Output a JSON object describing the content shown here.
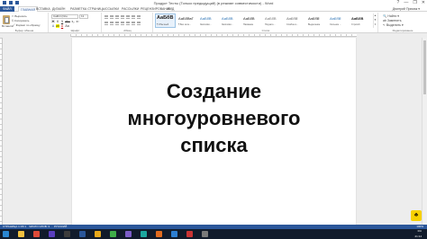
{
  "window": {
    "title": "Продукт Тесты (Только предыдущий) (в режиме совместимости) - Word",
    "controls": [
      "?",
      "—",
      "❐",
      "✕"
    ]
  },
  "tabs": [
    {
      "label": "ФАЙЛ",
      "kind": "file"
    },
    {
      "label": "ГЛАВНАЯ",
      "kind": "active"
    },
    {
      "label": "ВСТАВКА"
    },
    {
      "label": "ДИЗАЙН"
    },
    {
      "label": "РАЗМЕТКА СТРАНИЦЫ"
    },
    {
      "label": "ССЫЛКИ"
    },
    {
      "label": "РАССЫЛКИ"
    },
    {
      "label": "РЕЦЕНЗИРОВАНИЕ"
    },
    {
      "label": "ВИД"
    }
  ],
  "account": {
    "label": "Дмитрий Примак ▾"
  },
  "ribbon": {
    "clipboard": {
      "paste_label": "Вставить",
      "items": [
        "✂ Вырезать",
        "⎘ Копировать",
        "🖌 Формат по образцу"
      ],
      "group_label": "Буфер обмена"
    },
    "font": {
      "font_name": "Calibri (Осн",
      "font_size": "11",
      "row2": [
        "Ж",
        "К",
        "Ч",
        "abc",
        "x₂",
        "x²"
      ],
      "row3": [
        "A",
        "ab",
        "A",
        "Aa"
      ],
      "group_label": "Шрифт"
    },
    "paragraph": {
      "group_label": "Абзац"
    },
    "styles": {
      "items": [
        {
          "sample": "АаБбВ",
          "name": "¶ Обычный",
          "big": true,
          "selected": true
        },
        {
          "sample": "АаБбВвГ",
          "name": "¶ Без инте..."
        },
        {
          "sample": "АаБбВ",
          "name": "Заголово..."
        },
        {
          "sample": "АаБбВ",
          "name": "Заголово..."
        },
        {
          "sample": "АаБбВ",
          "name": "Название"
        },
        {
          "sample": "АаБбВ",
          "name": "Подзаго..."
        },
        {
          "sample": "АаБбВ",
          "name": "Слабое в..."
        },
        {
          "sample": "АаБбВ",
          "name": "Выделение"
        },
        {
          "sample": "АаБбВ",
          "name": "Сильное ..."
        },
        {
          "sample": "АаБбВ",
          "name": "Строгий"
        }
      ],
      "group_label": "Стили"
    },
    "editing": {
      "items": [
        "🔍 Найти ▾",
        "ab Заменить",
        "↖ Выделить ▾"
      ],
      "group_label": "Редактирование"
    }
  },
  "document": {
    "lines": [
      "Создание",
      "многоуровневого",
      "списка"
    ]
  },
  "statusbar": {
    "page": "СТРАНИЦА 1 ИЗ 1",
    "words": "ЧИСЛО СЛОВ: 3",
    "language": "РУССКИЙ",
    "zoom": "100%"
  },
  "taskbar": {
    "apps": [
      {
        "name": "start",
        "color": "#2a86d1"
      },
      {
        "name": "explorer",
        "color": "#f0c040"
      },
      {
        "name": "chrome",
        "color": "#dd4b39"
      },
      {
        "name": "media",
        "color": "#5a3fbf"
      },
      {
        "name": "terminal",
        "color": "#3c3c3c"
      },
      {
        "name": "word",
        "color": "#2b579a"
      },
      {
        "name": "files",
        "color": "#e7a81b"
      },
      {
        "name": "app-green",
        "color": "#3fae49"
      },
      {
        "name": "app-purple",
        "color": "#7b5dc7"
      },
      {
        "name": "app-teal",
        "color": "#1ca8a0"
      },
      {
        "name": "app-orange",
        "color": "#e06b1f"
      },
      {
        "name": "app-blue",
        "color": "#2d7fd3"
      },
      {
        "name": "app-red",
        "color": "#c93434"
      },
      {
        "name": "app-gray",
        "color": "#7a7a7a"
      }
    ],
    "tray": {
      "lang": "RU",
      "time": "21:14"
    }
  },
  "badge": {
    "glyph": "♣"
  },
  "colors": {
    "accent": "#2b579a",
    "taskbar": "#111b2b",
    "badge": "#f7d100"
  }
}
